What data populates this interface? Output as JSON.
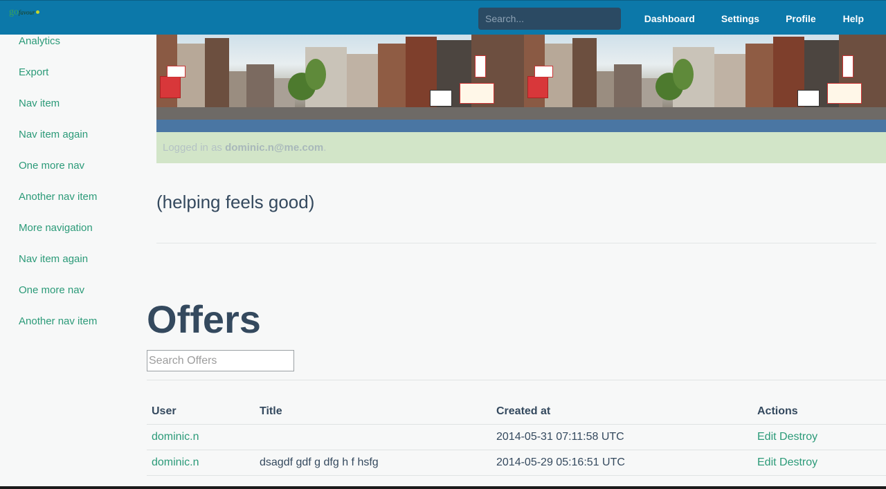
{
  "topbar": {
    "logo": {
      "part1": "go",
      "part2": "favour",
      "icon": "logo-mark"
    },
    "search_placeholder": "Search...",
    "links": [
      "Dashboard",
      "Settings",
      "Profile",
      "Help"
    ]
  },
  "sidebar": {
    "items": [
      "Analytics",
      "Export",
      "Nav item",
      "Nav item again",
      "One more nav",
      "Another nav item",
      "More navigation",
      "Nav item again",
      "One more nav",
      "Another nav item"
    ]
  },
  "banner": {
    "image": "street-scene-banner"
  },
  "login": {
    "prefix": "Logged in as ",
    "email": "dominic.n@me.com",
    "suffix": "."
  },
  "tagline": "(helping feels good)",
  "offers": {
    "heading": "Offers",
    "search_placeholder": "Search Offers",
    "columns": [
      "User",
      "Title",
      "Created at",
      "Actions"
    ],
    "rows": [
      {
        "user": "dominic.n",
        "title": "",
        "created_at": "2014-05-31 07:11:58 UTC",
        "edit": "Edit",
        "destroy": "Destroy"
      },
      {
        "user": "dominic.n",
        "title": "dsagdf gdf g dfg h f hsfg",
        "created_at": "2014-05-29 05:16:51 UTC",
        "edit": "Edit",
        "destroy": "Destroy"
      }
    ]
  },
  "colors": {
    "topbar": "#0c78a9",
    "link": "#2b9a78",
    "text": "#34495e",
    "login_bg": "#d2e5c8"
  }
}
